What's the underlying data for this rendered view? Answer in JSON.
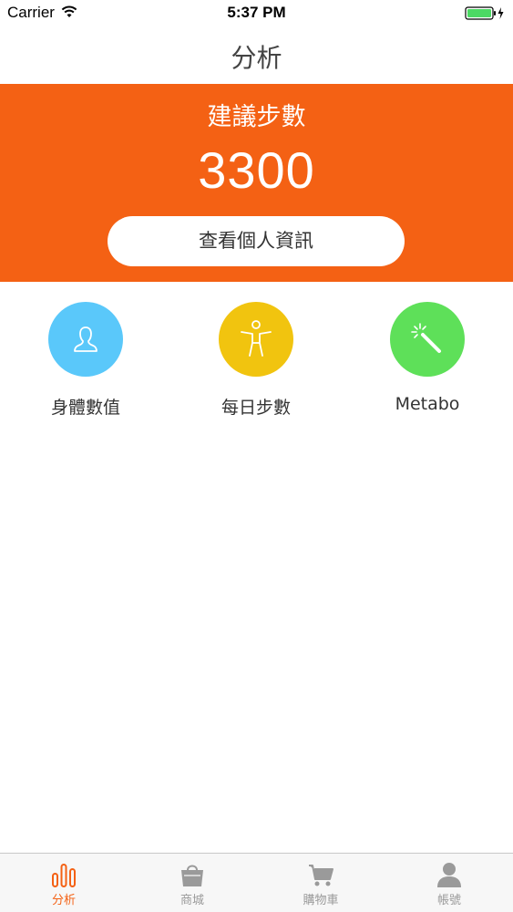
{
  "status_bar": {
    "carrier": "Carrier",
    "time": "5:37 PM",
    "battery_color": "#4cd964"
  },
  "nav": {
    "title": "分析"
  },
  "hero": {
    "label": "建議步數",
    "value": "3300",
    "button_label": "查看個人資訊",
    "background_color": "#f46114"
  },
  "features": [
    {
      "label": "身體數值",
      "icon": "person-icon",
      "color": "#5ac8fa"
    },
    {
      "label": "每日步數",
      "icon": "figure-icon",
      "color": "#f1c40f"
    },
    {
      "label": "Metabo",
      "icon": "magic-wand-icon",
      "color": "#5ee059"
    }
  ],
  "tab_bar": {
    "items": [
      {
        "label": "分析",
        "icon": "bar-chart-icon",
        "active": true
      },
      {
        "label": "商城",
        "icon": "shopping-bag-icon",
        "active": false
      },
      {
        "label": "購物車",
        "icon": "cart-icon",
        "active": false
      },
      {
        "label": "帳號",
        "icon": "user-icon",
        "active": false
      }
    ],
    "active_color": "#f46114",
    "inactive_color": "#9a9a9a"
  }
}
